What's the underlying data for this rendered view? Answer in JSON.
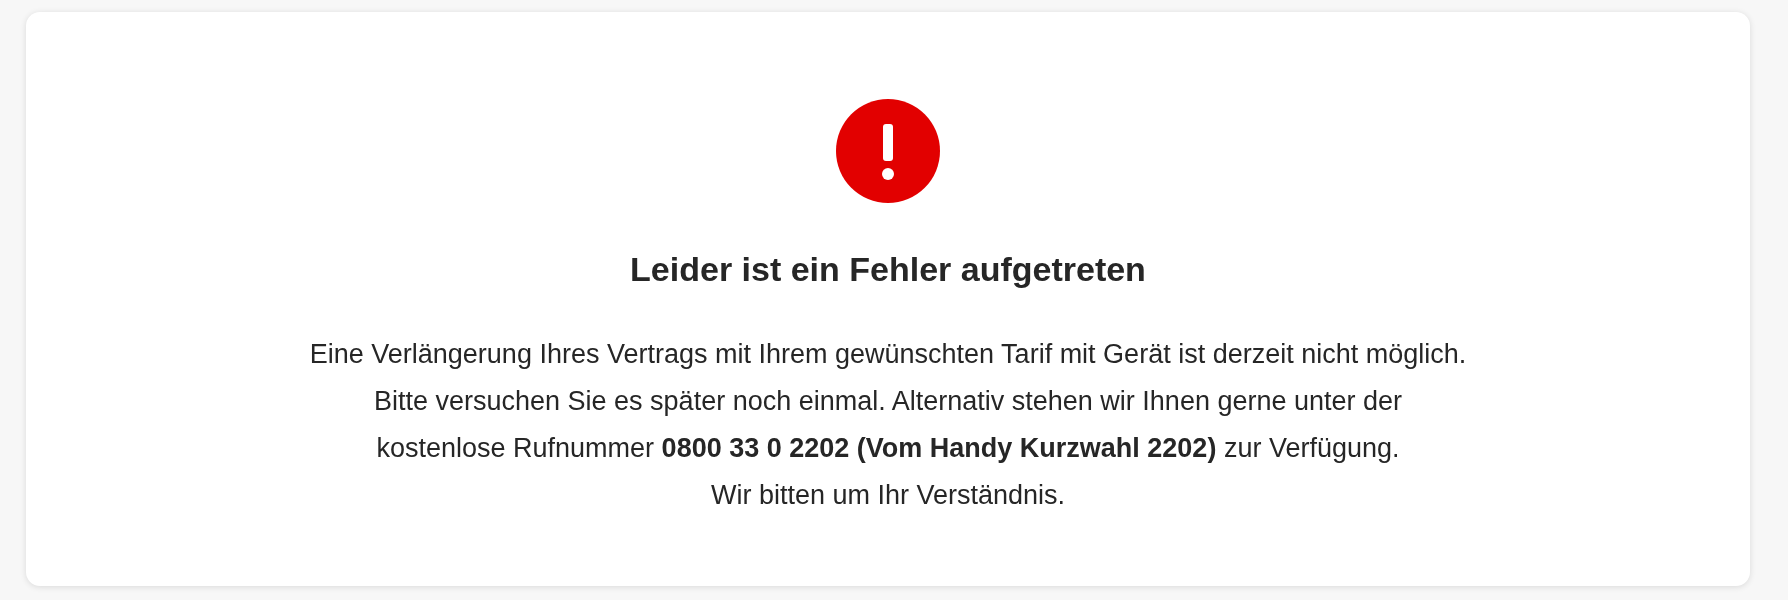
{
  "error_card": {
    "title": "Leider ist ein Fehler aufgetreten",
    "message_lines": [
      "Eine Verlängerung Ihres Vertrags mit Ihrem gewünschten Tarif mit Gerät ist derzeit nicht möglich.",
      "Bitte versuchen Sie es später noch einmal. Alternativ stehen wir Ihnen gerne unter der",
      "kostenlose Rufnummer **0800 33 0 2202 (Vom Handy Kurzwahl 2202)** zur Verfügung.",
      "Wir bitten um Ihr Verständnis."
    ]
  }
}
